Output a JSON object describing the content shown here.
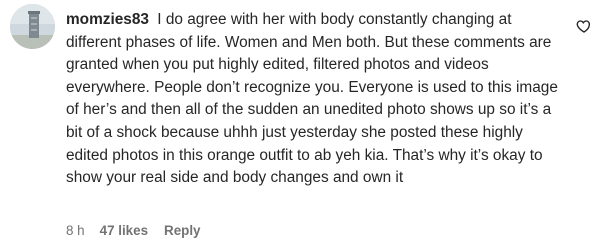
{
  "comment": {
    "username": "momzies83",
    "text": "I do agree with her with body constantly changing at different phases of life. Women and Men both. But these comments are granted when you put highly edited, filtered photos and videos everywhere. People don’t recognize you. Everyone is used to this image of her’s and then all of the sudden an unedited photo shows up so it’s a bit of a shock because uhhh just yesterday she posted these highly edited photos in this orange outfit to ab yeh kia. That’s why it’s okay to show your real side and body changes and own it",
    "time": "8 h",
    "likes": "47 likes",
    "reply_label": "Reply",
    "like_icon": "heart-outline-icon",
    "colors": {
      "text": "#262626",
      "meta": "#737373"
    }
  }
}
